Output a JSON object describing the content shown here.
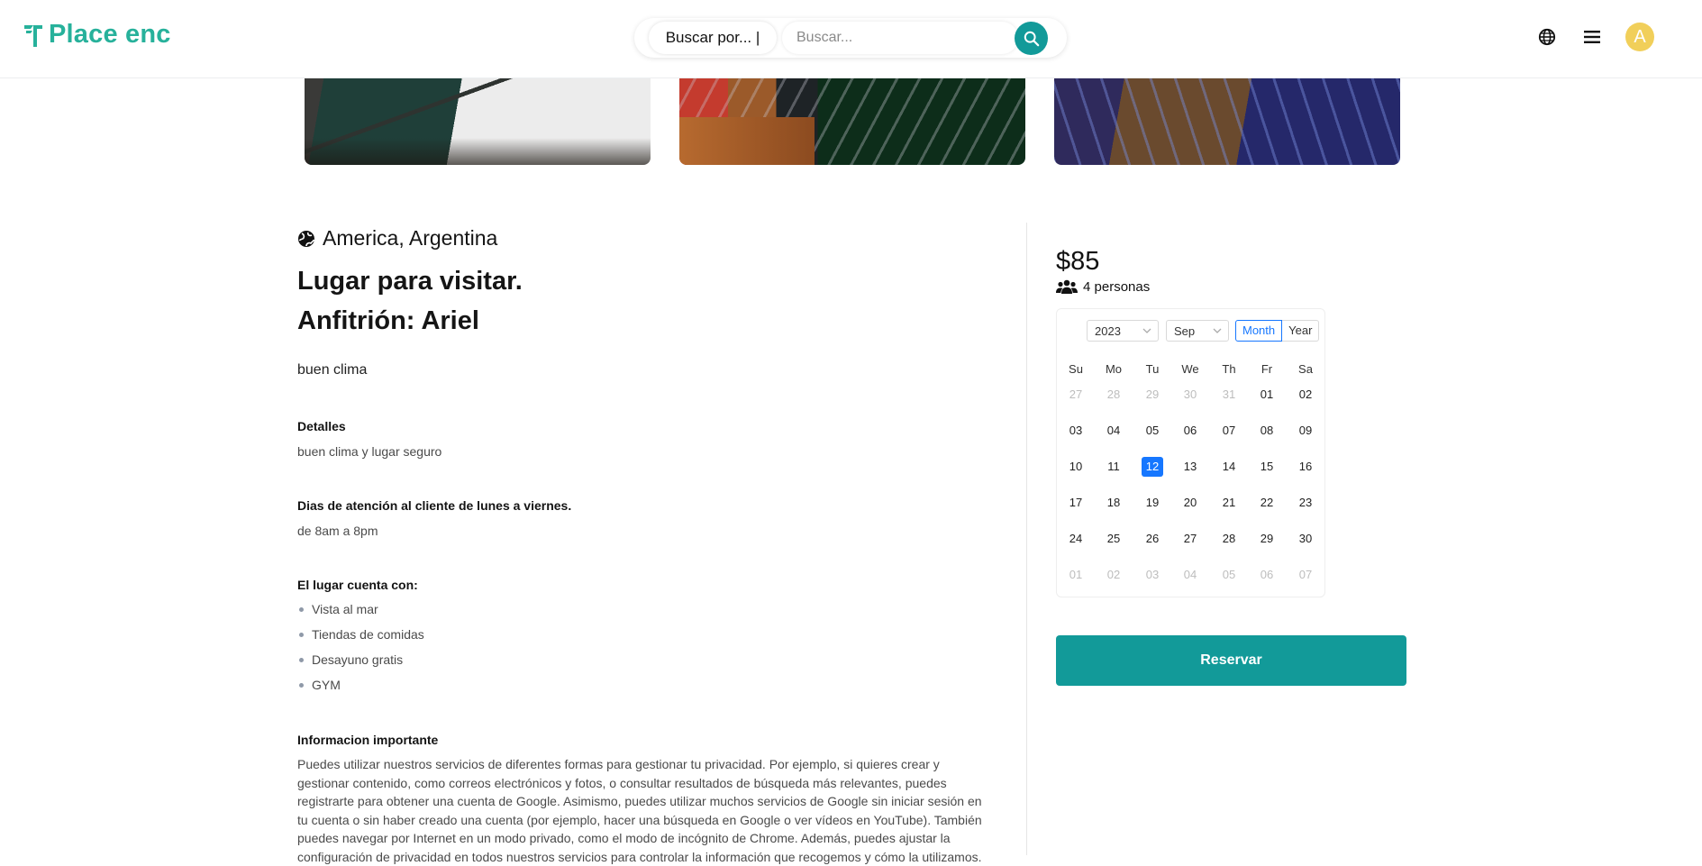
{
  "header": {
    "logo_text": "Place enc",
    "search_type_label": "Buscar por... |",
    "search_placeholder": "Buscar...",
    "avatar_initial": "A",
    "brand_color": "#27b19b",
    "accent_color": "#129a99"
  },
  "listing": {
    "location": "America, Argentina",
    "title": "Lugar para visitar.",
    "host": "Anfitrión: Ariel",
    "short_description": "buen clima",
    "details_heading": "Detalles",
    "details_text": "buen clima y lugar seguro",
    "service_heading": "Dias de atención al cliente de lunes a viernes.",
    "service_text": "de 8am a 8pm",
    "features_heading": "El lugar cuenta con:",
    "features": [
      "Vista al mar",
      "Tiendas de comidas",
      "Desayuno gratis",
      "GYM"
    ],
    "info_heading": "Informacion importante",
    "info_text": "Puedes utilizar nuestros servicios de diferentes formas para gestionar tu privacidad. Por ejemplo, si quieres crear y gestionar contenido, como correos electrónicos y fotos, o consultar resultados de búsqueda más relevantes, puedes registrarte para obtener una cuenta de Google. Asimismo, puedes utilizar muchos servicios de Google sin iniciar sesión en tu cuenta o sin haber creado una cuenta (por ejemplo, hacer una búsqueda en Google o ver vídeos en YouTube). También puedes navegar por Internet en un modo privado, como el modo de incógnito de Chrome. Además, puedes ajustar la configuración de privacidad en todos nuestros servicios para controlar la información que recogemos y cómo la utilizamos."
  },
  "booking": {
    "price": "$85",
    "guests": "4 personas",
    "calendar": {
      "year": "2023",
      "month": "Sep",
      "mode_month": "Month",
      "mode_year": "Year",
      "active_mode": "Month",
      "weekdays": [
        "Su",
        "Mo",
        "Tu",
        "We",
        "Th",
        "Fr",
        "Sa"
      ],
      "weeks": [
        [
          "27",
          "28",
          "29",
          "30",
          "31",
          "01",
          "02"
        ],
        [
          "03",
          "04",
          "05",
          "06",
          "07",
          "08",
          "09"
        ],
        [
          "10",
          "11",
          "12",
          "13",
          "14",
          "15",
          "16"
        ],
        [
          "17",
          "18",
          "19",
          "20",
          "21",
          "22",
          "23"
        ],
        [
          "24",
          "25",
          "26",
          "27",
          "28",
          "29",
          "30"
        ],
        [
          "01",
          "02",
          "03",
          "04",
          "05",
          "06",
          "07"
        ]
      ],
      "outside_month": [
        [
          0,
          0
        ],
        [
          0,
          1
        ],
        [
          0,
          2
        ],
        [
          0,
          3
        ],
        [
          0,
          4
        ],
        [
          5,
          0
        ],
        [
          5,
          1
        ],
        [
          5,
          2
        ],
        [
          5,
          3
        ],
        [
          5,
          4
        ],
        [
          5,
          5
        ],
        [
          5,
          6
        ]
      ],
      "selected_day": "12"
    },
    "reserve_label": "Reservar"
  }
}
